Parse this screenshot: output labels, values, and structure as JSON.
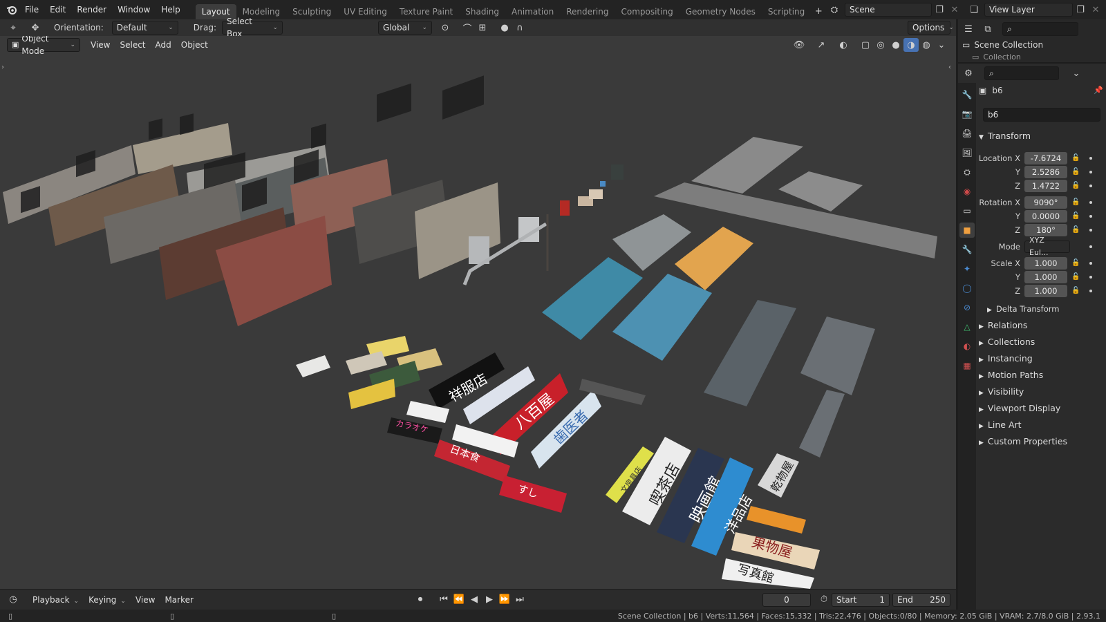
{
  "menu": [
    "File",
    "Edit",
    "Render",
    "Window",
    "Help"
  ],
  "workspaces": [
    "Layout",
    "Modeling",
    "Sculpting",
    "UV Editing",
    "Texture Paint",
    "Shading",
    "Animation",
    "Rendering",
    "Compositing",
    "Geometry Nodes",
    "Scripting"
  ],
  "active_workspace": "Layout",
  "scene": {
    "label": "Scene",
    "view_layer": "View Layer"
  },
  "toolbar": {
    "orientation_label": "Orientation:",
    "orientation_value": "Default",
    "drag_label": "Drag:",
    "drag_value": "Select Box",
    "transform_orientation": "Global",
    "options_label": "Options"
  },
  "viewport_header": {
    "mode": "Object Mode",
    "items": [
      "View",
      "Select",
      "Add",
      "Object"
    ]
  },
  "outliner": {
    "root": "Scene Collection",
    "child": "Collection"
  },
  "properties": {
    "object_name": "b6",
    "data_name": "b6",
    "transform": {
      "title": "Transform",
      "location_label": "Location X",
      "location": {
        "x": "-7.6724",
        "y": "2.5286",
        "z": "1.4722"
      },
      "rotation_label": "Rotation X",
      "rotation": {
        "x": "9090°",
        "y": "0.0000",
        "z": "180°"
      },
      "mode_label": "Mode",
      "mode_value": "XYZ Eul...",
      "scale_label": "Scale X",
      "scale": {
        "x": "1.000",
        "y": "1.000",
        "z": "1.000"
      },
      "y_label": "Y",
      "z_label": "Z",
      "delta": "Delta Transform"
    },
    "sections": [
      "Relations",
      "Collections",
      "Instancing",
      "Motion Paths",
      "Visibility",
      "Viewport Display",
      "Line Art",
      "Custom Properties"
    ]
  },
  "timeline": {
    "playback": "Playback",
    "keying": "Keying",
    "view": "View",
    "marker": "Marker",
    "current_frame": "0",
    "start_label": "Start",
    "start": "1",
    "end_label": "End",
    "end": "250"
  },
  "status": "Scene Collection | b6 | Verts:11,564 | Faces:15,332 | Tris:22,476 | Objects:0/80 | Memory: 2.05 GiB | VRAM: 2.7/8.0 GiB | 2.93.1",
  "signs": {
    "s1": "祥服店",
    "s2": "八百屋",
    "s3": "歯医者",
    "s4": "喫茶店",
    "s5": "映画館",
    "s6": "洋品店",
    "s7": "乾物屋",
    "s8": "果物屋",
    "s9": "写真館",
    "s10": "文房具店",
    "s11": "カラオケ",
    "s12": "日本食",
    "s13": "すし"
  },
  "colors": {
    "accent": "#4772b3",
    "header": "#303030",
    "viewport": "#3a3a3a",
    "panel": "#2b2b2b"
  }
}
